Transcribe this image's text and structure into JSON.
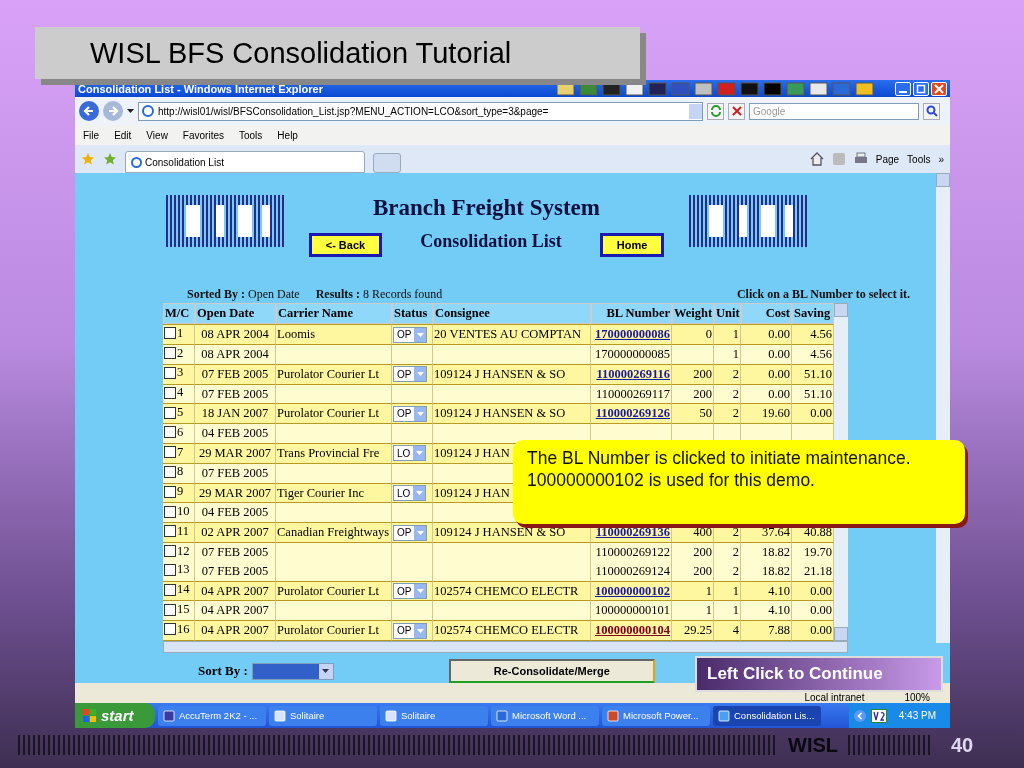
{
  "slide": {
    "title": "WISL BFS Consolidation Tutorial",
    "footer_brand": "WISL",
    "page_number": "40"
  },
  "browser": {
    "title": "Consolidation List - Windows Internet Explorer",
    "address": "http://wisl01/wisl/BFSConsolidation_List.jsp?MENU_ACTION=LCO&sort_type=3&page=",
    "search_placeholder": "Google",
    "menu": [
      "File",
      "Edit",
      "View",
      "Favorites",
      "Tools",
      "Help"
    ],
    "tab": "Consolidation List",
    "commands": [
      "Page",
      "Tools"
    ],
    "more": "»",
    "status_zone": "Local intranet",
    "zoom": "100%"
  },
  "page": {
    "heading": "Branch Freight System",
    "back_button": "<- Back",
    "subheading": "Consolidation List",
    "home_button": "Home",
    "sorted_by": "**Sorted By :** Open Date",
    "results": "**Results :** 8 Records found",
    "hint": "Click on a BL Number to select it.",
    "columns": [
      "M/C",
      "Open Date",
      "Carrier Name",
      "Status",
      "Consignee",
      "BL Number",
      "Weight",
      "Unit",
      "Cost",
      "Saving"
    ],
    "rows": [
      {
        "kind": "master",
        "mc": "1",
        "checked": false,
        "open_date": "08 APR 2004",
        "carrier": "Loomis",
        "status": "OP",
        "consignee": "20 VENTES AU COMPTAN",
        "bl": "170000000086",
        "bl_link": true,
        "visited": false,
        "weight": "0",
        "unit": "1",
        "cost": "0.00",
        "saving": "4.56"
      },
      {
        "kind": "detail",
        "mc": "2",
        "checked": false,
        "open_date": "08 APR 2004",
        "bl": "170000000085",
        "bl_link": false,
        "unit": "1",
        "cost": "0.00",
        "saving": "4.56"
      },
      {
        "kind": "master",
        "mc": "3",
        "checked": false,
        "open_date": "07 FEB 2005",
        "carrier": "Purolator Courier Lt",
        "status": "OP",
        "consignee": "109124 J HANSEN & SO",
        "bl": "110000269116",
        "bl_link": true,
        "visited": false,
        "weight": "200",
        "unit": "2",
        "cost": "0.00",
        "saving": "51.10"
      },
      {
        "kind": "detail",
        "mc": "4",
        "checked": false,
        "open_date": "07 FEB 2005",
        "bl": "110000269117",
        "bl_link": false,
        "weight": "200",
        "unit": "2",
        "cost": "0.00",
        "saving": "51.10"
      },
      {
        "kind": "master",
        "mc": "5",
        "checked": false,
        "open_date": "18 JAN 2007",
        "carrier": "Purolator Courier Lt",
        "status": "OP",
        "consignee": "109124 J HANSEN & SO",
        "bl": "110000269126",
        "bl_link": true,
        "visited": false,
        "weight": "50",
        "unit": "2",
        "cost": "19.60",
        "saving": "0.00"
      },
      {
        "kind": "detail",
        "mc": "6",
        "checked": false,
        "open_date": "04 FEB 2005"
      },
      {
        "kind": "master",
        "mc": "7",
        "checked": false,
        "open_date": "29 MAR 2007",
        "carrier": "Trans Provincial Fre",
        "status": "LO",
        "consignee": "109124 J HAN"
      },
      {
        "kind": "detail",
        "mc": "8",
        "checked": false,
        "open_date": "07 FEB 2005"
      },
      {
        "kind": "master",
        "mc": "9",
        "checked": false,
        "open_date": "29 MAR 2007",
        "carrier": "Tiger Courier Inc",
        "status": "LO",
        "consignee": "109124 J HAN"
      },
      {
        "kind": "detail",
        "mc": "10",
        "checked": false,
        "open_date": "04 FEB 2005"
      },
      {
        "kind": "master",
        "mc": "11",
        "checked": false,
        "open_date": "02 APR 2007",
        "carrier": "Canadian Freightways",
        "status": "OP",
        "consignee": "109124 J HANSEN & SO",
        "bl": "110000269136",
        "bl_link": true,
        "visited": false,
        "weight": "400",
        "unit": "2",
        "cost": "37.64",
        "saving": "40.88"
      },
      {
        "kind": "detail",
        "mc": "12",
        "checked": false,
        "open_date": "07 FEB 2005",
        "bl": "110000269122",
        "bl_link": false,
        "weight": "200",
        "unit": "2",
        "cost": "18.82",
        "saving": "19.70"
      },
      {
        "kind": "detail",
        "mc": "13",
        "checked": false,
        "open_date": "07 FEB 2005",
        "bl": "110000269124",
        "bl_link": false,
        "weight": "200",
        "unit": "2",
        "cost": "18.82",
        "saving": "21.18"
      },
      {
        "kind": "master",
        "mc": "14",
        "checked": false,
        "open_date": "04 APR 2007",
        "carrier": "Purolator Courier Lt",
        "status": "OP",
        "consignee": "102574 CHEMCO ELECTR",
        "bl": "100000000102",
        "bl_link": true,
        "visited": false,
        "weight": "1",
        "unit": "1",
        "cost": "4.10",
        "saving": "0.00"
      },
      {
        "kind": "detail",
        "mc": "15",
        "checked": false,
        "open_date": "04 APR 2007",
        "bl": "100000000101",
        "bl_link": false,
        "weight": "1",
        "unit": "1",
        "cost": "4.10",
        "saving": "0.00"
      },
      {
        "kind": "master",
        "mc": "16",
        "checked": false,
        "open_date": "04 APR 2007",
        "carrier": "Purolator Courier Lt",
        "status": "OP",
        "consignee": "102574 CHEMCO ELECTR",
        "bl": "100000000104",
        "bl_link": true,
        "visited": true,
        "weight": "29.25",
        "unit": "4",
        "cost": "7.88",
        "saving": "0.00"
      }
    ],
    "sort_by_label": "Sort By :",
    "merge_button": "Re-Consolidate/Merge"
  },
  "callout": "The BL Number is clicked to initiate maintenance. 100000000102 is used for this demo.",
  "continue_button": "Left Click to Continue",
  "taskbar": {
    "start": "start",
    "tasks": [
      {
        "label": "AccuTerm 2K2 - ...",
        "kind": "terminal",
        "selected": false
      },
      {
        "label": "Solitaire",
        "kind": "cards",
        "selected": false
      },
      {
        "label": "Solitaire",
        "kind": "cards",
        "selected": false
      },
      {
        "label": "Microsoft Word ...",
        "kind": "word",
        "selected": false
      },
      {
        "label": "Microsoft Power...",
        "kind": "slides",
        "selected": false
      },
      {
        "label": "Consolidation Lis...",
        "kind": "browser",
        "selected": true
      }
    ],
    "clock": "4:43 PM"
  }
}
